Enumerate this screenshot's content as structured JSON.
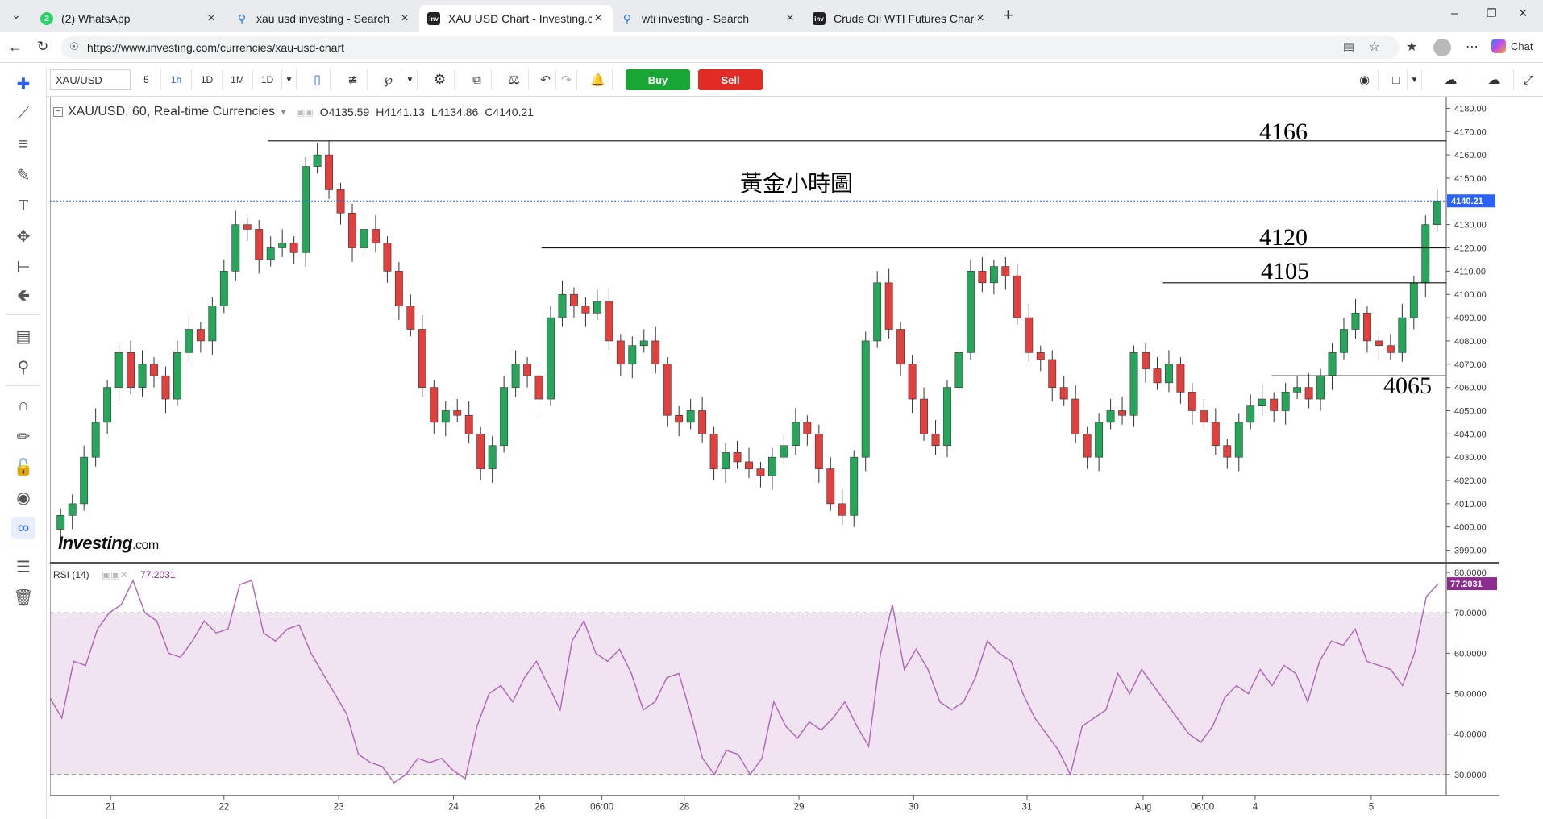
{
  "browser": {
    "tabs": [
      {
        "title": "(2) WhatsApp",
        "badge": "2",
        "favicon": "whatsapp-icon",
        "color": "#25d366"
      },
      {
        "title": "xau usd investing - Search",
        "favicon": "search-icon",
        "color": "#1a73e8"
      },
      {
        "title": "XAU USD Chart - Investing.com",
        "favicon": "investing-icon",
        "color": "#222222",
        "active": true
      },
      {
        "title": "wti investing - Search",
        "favicon": "search-icon",
        "color": "#1a73e8"
      },
      {
        "title": "Crude Oil WTI Futures Chart - Inve",
        "favicon": "investing-icon",
        "color": "#222222"
      }
    ],
    "url": "https://www.investing.com/currencies/xau-usd-chart",
    "chat_label": "Chat"
  },
  "toolbar": {
    "symbol": "XAU/USD",
    "intervals": [
      "5",
      "1h",
      "1D",
      "1M",
      "1D"
    ],
    "active_interval": "1h",
    "buy_label": "Buy",
    "sell_label": "Sell"
  },
  "legend": {
    "title": "XAU/USD, 60, Real-time Currencies",
    "open": "O4135.59",
    "high": "H4141.13",
    "low": "L4134.86",
    "close": "C4140.21"
  },
  "rsi_legend": {
    "label": "RSI (14)",
    "value": "77.2031"
  },
  "logo": {
    "text": "Investing",
    "suffix": ".com"
  },
  "annotations": {
    "title": "黃金小時圖",
    "levels": [
      "4166",
      "4120",
      "4105",
      "4065"
    ]
  },
  "colors": {
    "up": "#26a65b",
    "down": "#e0413f",
    "rsi": "#b36bb9",
    "rsi_band": "#f1e4f1",
    "price_tag": "#2962ff",
    "rsi_tag": "#8b2c8f"
  },
  "chart_data": [
    {
      "type": "candlestick",
      "title": "XAU/USD, 60, Real-time Currencies",
      "ylim": [
        3985,
        4185
      ],
      "y_ticks": [
        3990,
        4000,
        4010,
        4020,
        4030,
        4040,
        4050,
        4060,
        4070,
        4080,
        4090,
        4100,
        4110,
        4120,
        4130,
        4140,
        4150,
        4160,
        4170,
        4180
      ],
      "x_tick_labels": [
        "21",
        "22",
        "23",
        "24",
        "26",
        "06:00",
        "28",
        "29",
        "30",
        "31",
        "Aug",
        "06:00",
        "4",
        "5"
      ],
      "last_price": "4140.21",
      "horizontal_levels": [
        4166,
        4120,
        4105,
        4065
      ],
      "closes": [
        4005,
        4010,
        4030,
        4045,
        4060,
        4075,
        4060,
        4070,
        4065,
        4055,
        4075,
        4085,
        4080,
        4095,
        4110,
        4130,
        4128,
        4115,
        4120,
        4122,
        4118,
        4155,
        4160,
        4145,
        4135,
        4120,
        4128,
        4122,
        4110,
        4095,
        4085,
        4060,
        4045,
        4050,
        4048,
        4040,
        4025,
        4035,
        4060,
        4070,
        4065,
        4055,
        4090,
        4100,
        4095,
        4092,
        4097,
        4080,
        4070,
        4078,
        4080,
        4070,
        4048,
        4045,
        4050,
        4040,
        4025,
        4032,
        4028,
        4025,
        4022,
        4030,
        4035,
        4045,
        4040,
        4025,
        4010,
        4005,
        4030,
        4080,
        4105,
        4085,
        4070,
        4055,
        4040,
        4035,
        4060,
        4075,
        4110,
        4105,
        4112,
        4108,
        4090,
        4075,
        4072,
        4060,
        4055,
        4040,
        4030,
        4045,
        4050,
        4048,
        4075,
        4068,
        4062,
        4070,
        4058,
        4050,
        4045,
        4035,
        4030,
        4045,
        4052,
        4055,
        4050,
        4058,
        4060,
        4055,
        4065,
        4075,
        4085,
        4092,
        4080,
        4078,
        4075,
        4090,
        4105,
        4130,
        4140.21
      ]
    },
    {
      "type": "line",
      "title": "RSI (14)",
      "ylim": [
        25,
        82
      ],
      "y_ticks": [
        30,
        40,
        50,
        60,
        70,
        80
      ],
      "bands": [
        30,
        70
      ],
      "last_value": "77.2031",
      "values": [
        49,
        44,
        58,
        57,
        66,
        70,
        72,
        78,
        70,
        68,
        60,
        59,
        63,
        68,
        65,
        66,
        77,
        78,
        65,
        63,
        66,
        67,
        60,
        55,
        50,
        45,
        35,
        33,
        32,
        28,
        30,
        34,
        33,
        34,
        31,
        29,
        42,
        50,
        52,
        48,
        54,
        58,
        52,
        46,
        63,
        68,
        60,
        58,
        61,
        55,
        46,
        48,
        54,
        55,
        45,
        34,
        30,
        36,
        35,
        30,
        34,
        48,
        42,
        39,
        43,
        41,
        44,
        48,
        42,
        37,
        60,
        72,
        56,
        61,
        56,
        48,
        46,
        48,
        54,
        63,
        60,
        58,
        50,
        44,
        40,
        36,
        30,
        42,
        44,
        46,
        55,
        50,
        56,
        52,
        48,
        44,
        40,
        38,
        42,
        49,
        52,
        50,
        56,
        52,
        57,
        55,
        48,
        58,
        63,
        62,
        66,
        58,
        57,
        56,
        52,
        60,
        74,
        77.2
      ]
    }
  ]
}
